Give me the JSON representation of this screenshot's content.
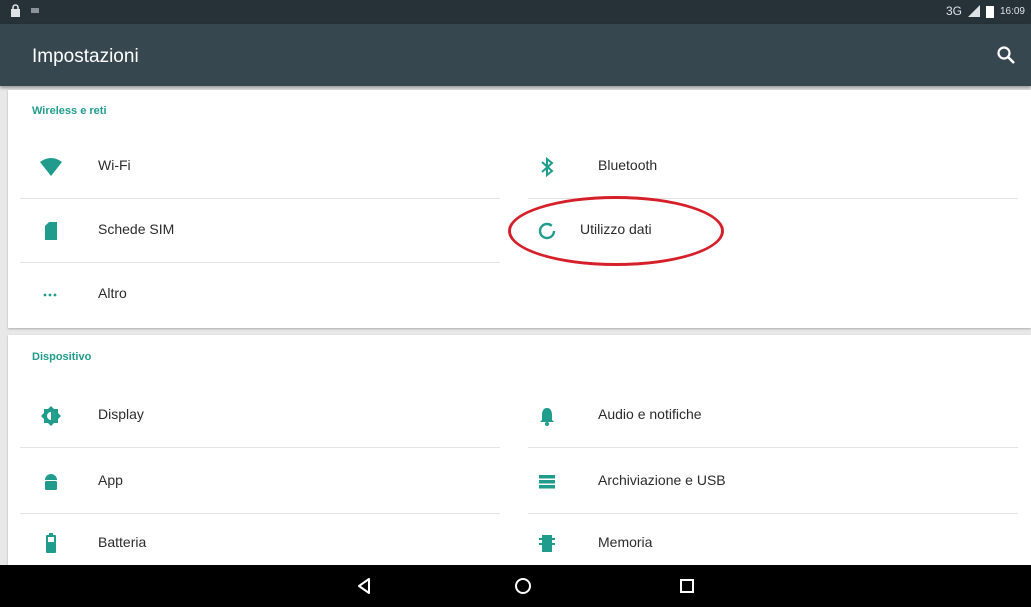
{
  "statusbar": {
    "network": "3G",
    "time": "16:09"
  },
  "appbar": {
    "title": "Impostazioni"
  },
  "sections": [
    {
      "title": "Wireless e reti",
      "items": [
        {
          "label": "Wi-Fi",
          "icon": "wifi-icon"
        },
        {
          "label": "Bluetooth",
          "icon": "bluetooth-icon"
        },
        {
          "label": "Schede SIM",
          "icon": "sim-card-icon"
        },
        {
          "label": "Utilizzo dati",
          "icon": "data-usage-icon"
        },
        {
          "label": "Altro",
          "icon": "more-horiz-icon"
        }
      ]
    },
    {
      "title": "Dispositivo",
      "items": [
        {
          "label": "Display",
          "icon": "brightness-icon"
        },
        {
          "label": "Audio e notifiche",
          "icon": "bell-icon"
        },
        {
          "label": "App",
          "icon": "android-icon"
        },
        {
          "label": "Archiviazione e USB",
          "icon": "storage-icon"
        },
        {
          "label": "Batteria",
          "icon": "battery-icon"
        },
        {
          "label": "Memoria",
          "icon": "memory-icon"
        }
      ]
    }
  ],
  "colors": {
    "accent": "#1f9c8b",
    "appbar": "#37474f",
    "statusbar": "#263238",
    "annotation": "#d5202a"
  }
}
